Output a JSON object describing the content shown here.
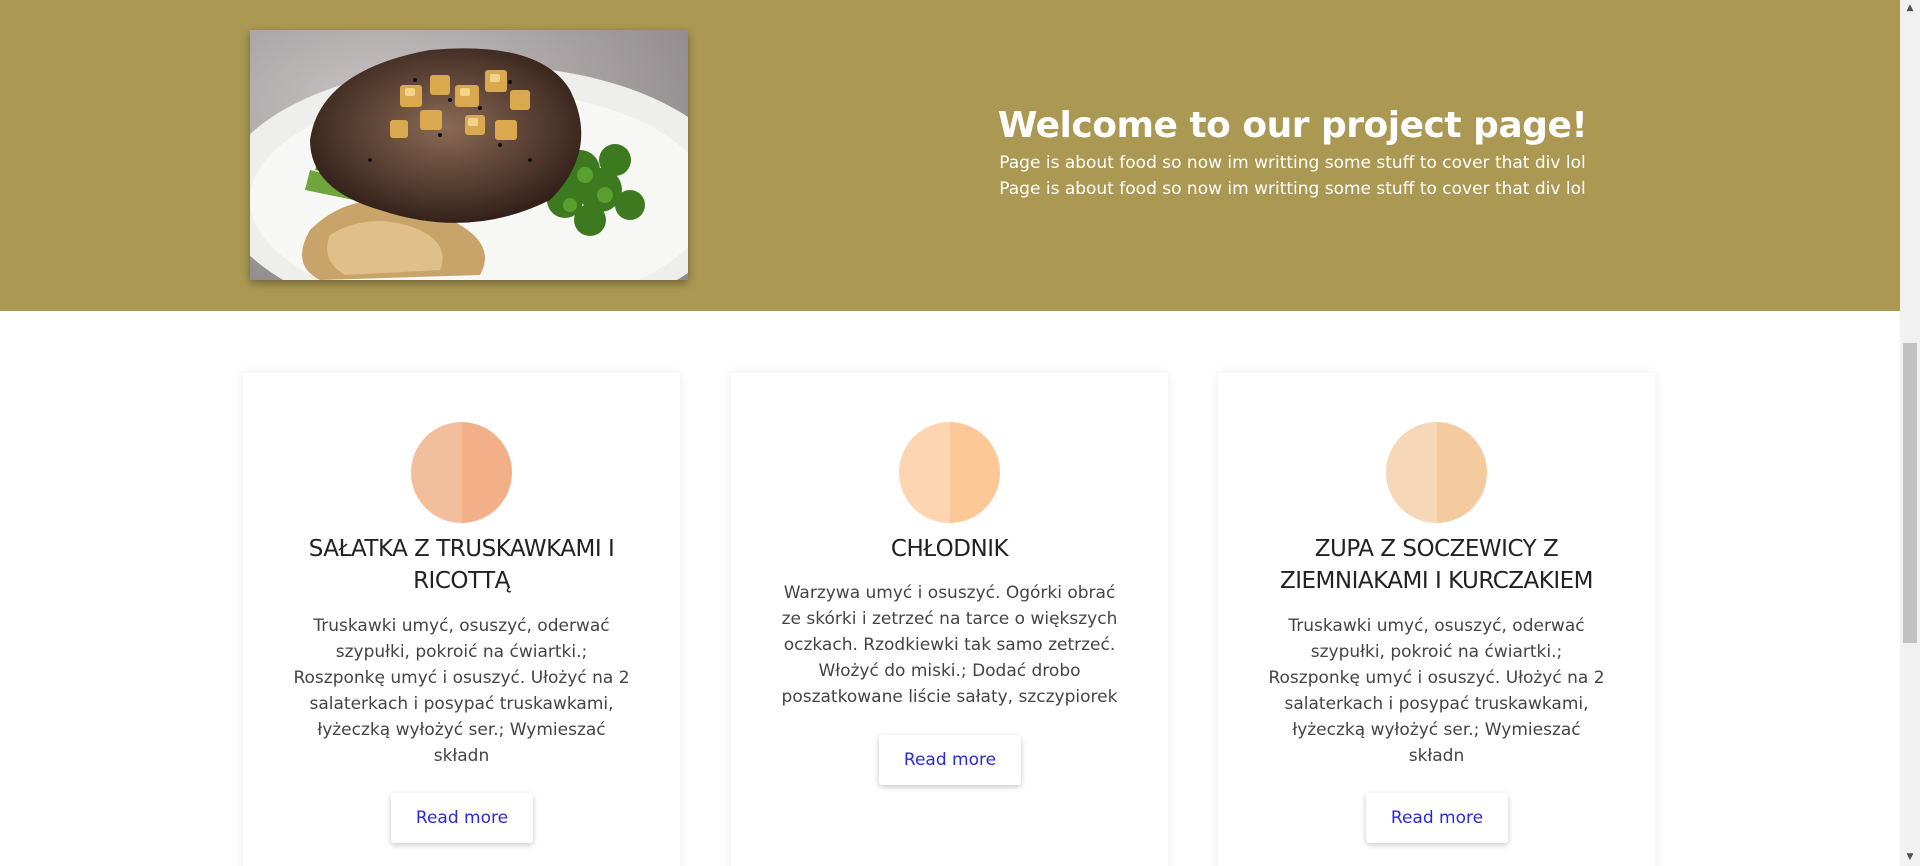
{
  "hero": {
    "title": "Welcome to our project page!",
    "subtitle_line_1": "Page is about food so now im writting some stuff to cover that div lol",
    "subtitle_line_2": "Page is about food so now im writting some stuff to cover that div lol",
    "background_color": "#ab9852",
    "image_icon": "food-photo-grilled-meat"
  },
  "cards": [
    {
      "title": "SAŁATKA Z TRUSKAWKAMI I RICOTTĄ",
      "text": "Truskawki umyć, osuszyć, oderwać szypułki, pokroić na ćwiartki.; Roszponkę umyć i osuszyć. Ułożyć na 2 salaterkach i posypać truskawkami, łyżeczką wyłożyć ser.; Wymieszać składn",
      "button_label": "Read more",
      "circle_colors": [
        "#f3be9c",
        "#f3b088"
      ]
    },
    {
      "title": "CHŁODNIK",
      "text": "Warzywa umyć i osuszyć. Ogórki obrać ze skórki i zetrzeć na tarce o większych oczkach. Rzodkiewki tak samo zetrzeć. Włożyć do miski.; Dodać drobo poszatkowane liście sałaty, szczypiorek",
      "button_label": "Read more",
      "circle_colors": [
        "#fdd5b0",
        "#fcc898"
      ]
    },
    {
      "title": "ZUPA Z SOCZEWICY Z ZIEMNIAKAMI I KURCZAKIEM",
      "text": "Truskawki umyć, osuszyć, oderwać szypułki, pokroić na ćwiartki.; Roszponkę umyć i osuszyć. Ułożyć na 2 salaterkach i posypać truskawkami, łyżeczką wyłożyć ser.; Wymieszać składn",
      "button_label": "Read more",
      "circle_colors": [
        "#f6d8b9",
        "#f4ca9f"
      ]
    }
  ],
  "colors": {
    "link": "#2a2ad9",
    "heading": "#222222"
  }
}
